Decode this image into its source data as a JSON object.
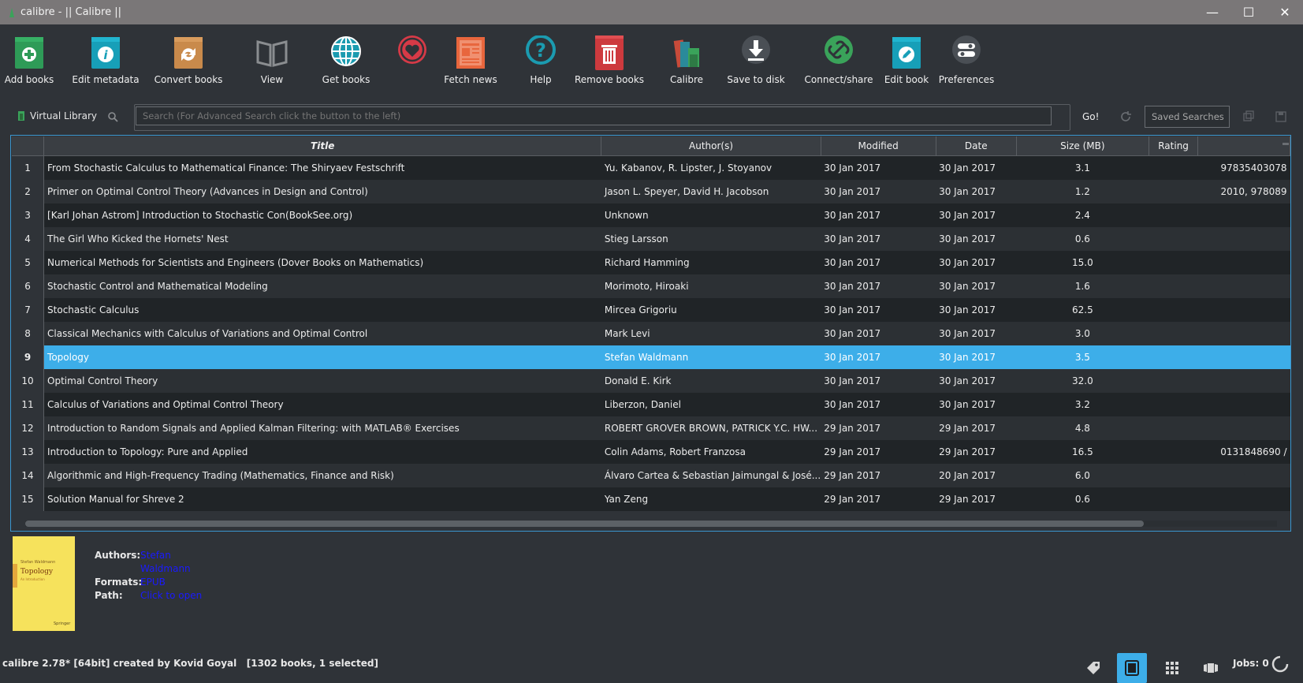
{
  "window": {
    "title": "calibre - || Calibre ||",
    "minimize_glyph": "—",
    "maximize_glyph": "☐",
    "close_glyph": "✕"
  },
  "toolbar": [
    {
      "label": "Add books",
      "icon": "add-books-icon"
    },
    {
      "label": "Edit metadata",
      "icon": "edit-metadata-icon"
    },
    {
      "label": "Convert books",
      "icon": "convert-books-icon"
    },
    {
      "label": "View",
      "icon": "view-icon"
    },
    {
      "label": "Get books",
      "icon": "get-books-icon"
    },
    {
      "label": "",
      "icon": "donate-heart-icon"
    },
    {
      "label": "Fetch news",
      "icon": "fetch-news-icon"
    },
    {
      "label": "Help",
      "icon": "help-icon"
    },
    {
      "label": "Remove books",
      "icon": "remove-books-icon"
    },
    {
      "label": "Calibre",
      "icon": "calibre-library-icon"
    },
    {
      "label": "Save to disk",
      "icon": "save-to-disk-icon"
    },
    {
      "label": "Connect/share",
      "icon": "connect-share-icon"
    },
    {
      "label": "Edit book",
      "icon": "edit-book-icon"
    },
    {
      "label": "Preferences",
      "icon": "preferences-icon"
    }
  ],
  "search": {
    "virtual_library": "Virtual Library",
    "placeholder": "Search (For Advanced Search click the button to the left)",
    "go": "Go!",
    "saved_searches": "Saved Searches"
  },
  "columns": [
    "Title",
    "Author(s)",
    "Modified",
    "Date",
    "Size (MB)",
    "Rating",
    ""
  ],
  "books": [
    {
      "n": "1",
      "title": "From Stochastic Calculus to Mathematical Finance: The Shiryaev Festschrift",
      "authors": "Yu. Kabanov, R. Lipster, J. Stoyanov",
      "modified": "30 Jan 2017",
      "date": "30 Jan 2017",
      "size": "3.1",
      "rating": "",
      "isbn": "97835403078"
    },
    {
      "n": "2",
      "title": "Primer on Optimal Control Theory (Advances in Design and Control)",
      "authors": "Jason L. Speyer, David H. Jacobson",
      "modified": "30 Jan 2017",
      "date": "30 Jan 2017",
      "size": "1.2",
      "rating": "",
      "isbn": "2010, 978089"
    },
    {
      "n": "3",
      "title": "[Karl Johan Astrom] Introduction to Stochastic Con(BookSee.org)",
      "authors": "Unknown",
      "modified": "30 Jan 2017",
      "date": "30 Jan 2017",
      "size": "2.4",
      "rating": "",
      "isbn": ""
    },
    {
      "n": "4",
      "title": "The Girl Who Kicked the Hornets' Nest",
      "authors": "Stieg Larsson",
      "modified": "30 Jan 2017",
      "date": "30 Jan 2017",
      "size": "0.6",
      "rating": "",
      "isbn": ""
    },
    {
      "n": "5",
      "title": "Numerical Methods for Scientists and Engineers (Dover Books on Mathematics)",
      "authors": "Richard Hamming",
      "modified": "30 Jan 2017",
      "date": "30 Jan 2017",
      "size": "15.0",
      "rating": "",
      "isbn": ""
    },
    {
      "n": "6",
      "title": "Stochastic Control and Mathematical Modeling",
      "authors": "Morimoto, Hiroaki",
      "modified": "30 Jan 2017",
      "date": "30 Jan 2017",
      "size": "1.6",
      "rating": "",
      "isbn": ""
    },
    {
      "n": "7",
      "title": "Stochastic Calculus",
      "authors": "Mircea Grigoriu",
      "modified": "30 Jan 2017",
      "date": "30 Jan 2017",
      "size": "62.5",
      "rating": "",
      "isbn": ""
    },
    {
      "n": "8",
      "title": "Classical Mechanics with Calculus of Variations and Optimal Control",
      "authors": "Mark Levi",
      "modified": "30 Jan 2017",
      "date": "30 Jan 2017",
      "size": "3.0",
      "rating": "",
      "isbn": ""
    },
    {
      "n": "9",
      "title": "Topology",
      "authors": "Stefan Waldmann",
      "modified": "30 Jan 2017",
      "date": "30 Jan 2017",
      "size": "3.5",
      "rating": "",
      "isbn": "",
      "selected": true
    },
    {
      "n": "10",
      "title": "Optimal Control Theory",
      "authors": "Donald E. Kirk",
      "modified": "30 Jan 2017",
      "date": "30 Jan 2017",
      "size": "32.0",
      "rating": "",
      "isbn": ""
    },
    {
      "n": "11",
      "title": "Calculus of Variations and Optimal Control Theory",
      "authors": "Liberzon, Daniel",
      "modified": "30 Jan 2017",
      "date": "30 Jan 2017",
      "size": "3.2",
      "rating": "",
      "isbn": ""
    },
    {
      "n": "12",
      "title": "Introduction to Random Signals and Applied Kalman Filtering: with MATLAB® Exercises",
      "authors": "ROBERT GROVER BROWN, PATRICK Y.C. HW...",
      "modified": "29 Jan 2017",
      "date": "29 Jan 2017",
      "size": "4.8",
      "rating": "",
      "isbn": ""
    },
    {
      "n": "13",
      "title": "Introduction to Topology: Pure and Applied",
      "authors": "Colin Adams, Robert Franzosa",
      "modified": "29 Jan 2017",
      "date": "29 Jan 2017",
      "size": "16.5",
      "rating": "",
      "isbn": "0131848690 /"
    },
    {
      "n": "14",
      "title": "Algorithmic and High-Frequency Trading (Mathematics, Finance and Risk)",
      "authors": "Álvaro Cartea & Sebastian Jaimungal & José...",
      "modified": "29 Jan 2017",
      "date": "20 Jan 2017",
      "size": "6.0",
      "rating": "",
      "isbn": ""
    },
    {
      "n": "15",
      "title": "Solution Manual for Shreve 2",
      "authors": "Yan Zeng",
      "modified": "29 Jan 2017",
      "date": "29 Jan 2017",
      "size": "0.6",
      "rating": "",
      "isbn": ""
    }
  ],
  "details": {
    "cover": {
      "author": "Stefan Waldmann",
      "title": "Topology",
      "subtitle": "An Introduction",
      "publisher": "Springer"
    },
    "authors_label": "Authors:",
    "authors_line1": "Stefan",
    "authors_line2": "Waldmann",
    "formats_label": "Formats:",
    "formats_value": "EPUB",
    "path_label": "Path:",
    "path_value": "Click to open"
  },
  "status": {
    "text": "calibre 2.78* [64bit] created by Kovid Goyal   [1302 books, 1 selected]",
    "jobs": "Jobs: 0"
  },
  "colors": {
    "selection": "#3daee9",
    "link": "#1a1aff",
    "background": "#2f3338"
  }
}
